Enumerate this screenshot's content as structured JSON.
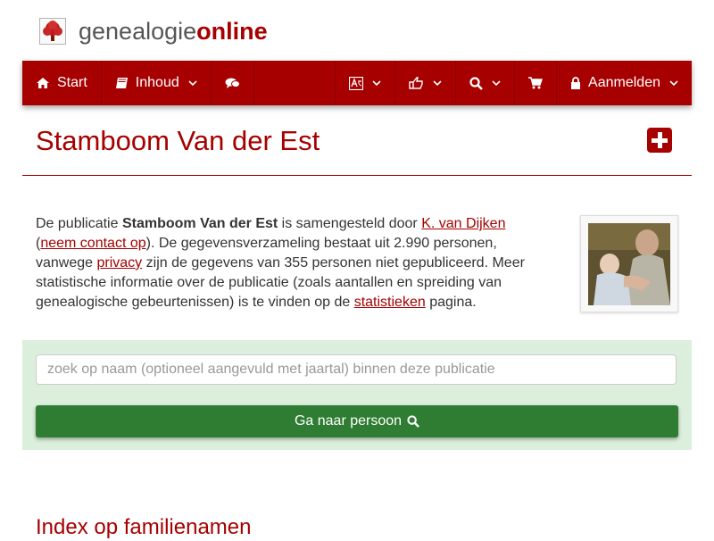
{
  "logo": {
    "part1": "genealogie",
    "part2": "online"
  },
  "nav": {
    "start": "Start",
    "inhoud": "Inhoud",
    "aanmelden": "Aanmelden"
  },
  "icons": {
    "home": "home-icon",
    "book": "book-icon",
    "chat": "comments-icon",
    "language": "language-icon",
    "share": "share-icon",
    "search": "search-icon",
    "cart": "shopping-cart-icon",
    "lock": "lock-icon",
    "plus": "plus-square-icon"
  },
  "page": {
    "title": "Stamboom Van der Est"
  },
  "intro": {
    "t1": "De publicatie ",
    "pub_name": "Stamboom Van der Est",
    "t2": " is samengesteld door ",
    "author": "K. van Dijken",
    "t3": "(",
    "contact": "neem contact op",
    "t4": "). De gegevensverzameling bestaat uit 2.990 personen, vanwege ",
    "privacy": "privacy",
    "t5": " zijn de gegevens van 355 personen niet gepubliceerd. Meer statistische informatie over de publicatie (zoals aantallen en spreiding van genealogische gebeurtenissen) is te vinden op de ",
    "stats": "statistieken",
    "t6": " pagina."
  },
  "search": {
    "placeholder": "zoek op naam (optioneel aangevuld met jaartal) binnen deze publicatie",
    "button": "Ga naar persoon"
  },
  "sections": {
    "index_heading": "Index op familienamen"
  },
  "colors": {
    "brand": "#a60000",
    "panel": "#dcefdc",
    "button": "#2e7d32"
  }
}
